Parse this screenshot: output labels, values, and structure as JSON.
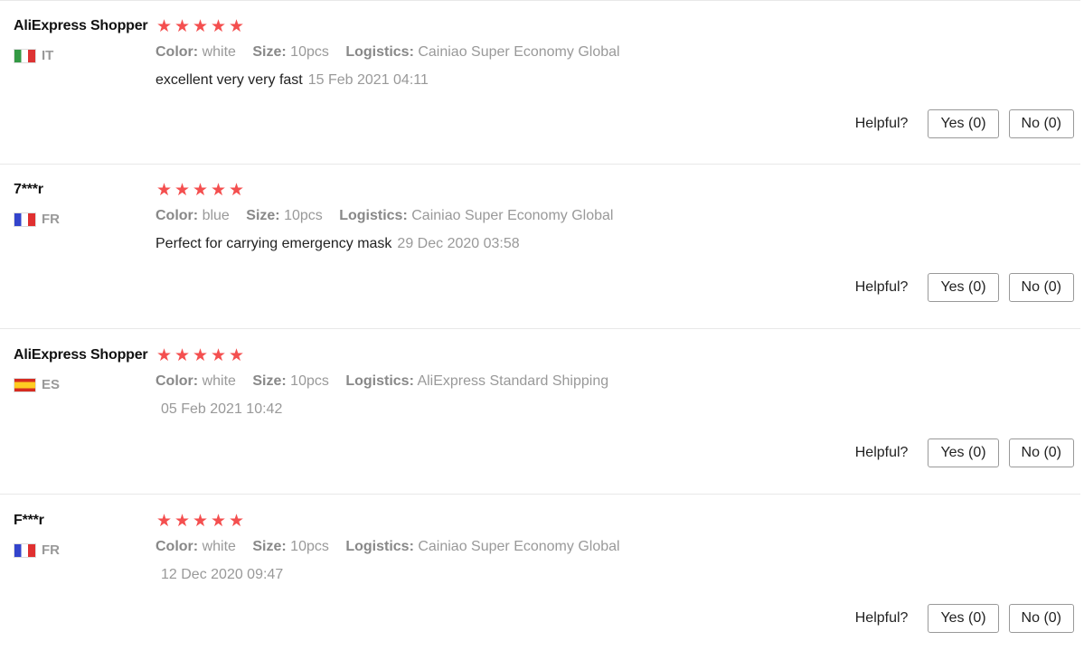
{
  "helpful_label": "Helpful?",
  "star_color": "#f44f4f",
  "reviews": [
    {
      "user": "AliExpress Shopper",
      "country": "IT",
      "flag": "italy-flag-icon",
      "rating": 5,
      "color_label": "Color:",
      "color": "white",
      "size_label": "Size:",
      "size": "10pcs",
      "logistics_label": "Logistics:",
      "logistics": "Cainiao Super Economy Global",
      "text": "excellent very very fast",
      "date": "15 Feb 2021 04:11",
      "yes": "Yes (0)",
      "no": "No (0)"
    },
    {
      "user": "7***r",
      "country": "FR",
      "flag": "france-flag-icon",
      "rating": 5,
      "color_label": "Color:",
      "color": "blue",
      "size_label": "Size:",
      "size": "10pcs",
      "logistics_label": "Logistics:",
      "logistics": "Cainiao Super Economy Global",
      "text": "Perfect for carrying emergency mask",
      "date": "29 Dec 2020 03:58",
      "yes": "Yes (0)",
      "no": "No (0)"
    },
    {
      "user": "AliExpress Shopper",
      "country": "ES",
      "flag": "spain-flag-icon",
      "rating": 5,
      "color_label": "Color:",
      "color": "white",
      "size_label": "Size:",
      "size": "10pcs",
      "logistics_label": "Logistics:",
      "logistics": "AliExpress Standard Shipping",
      "text": "",
      "date": "05 Feb 2021 10:42",
      "yes": "Yes (0)",
      "no": "No (0)"
    },
    {
      "user": "F***r",
      "country": "FR",
      "flag": "france-flag-icon",
      "rating": 5,
      "color_label": "Color:",
      "color": "white",
      "size_label": "Size:",
      "size": "10pcs",
      "logistics_label": "Logistics:",
      "logistics": "Cainiao Super Economy Global",
      "text": "",
      "date": "12 Dec 2020 09:47",
      "yes": "Yes (0)",
      "no": "No (0)"
    }
  ]
}
